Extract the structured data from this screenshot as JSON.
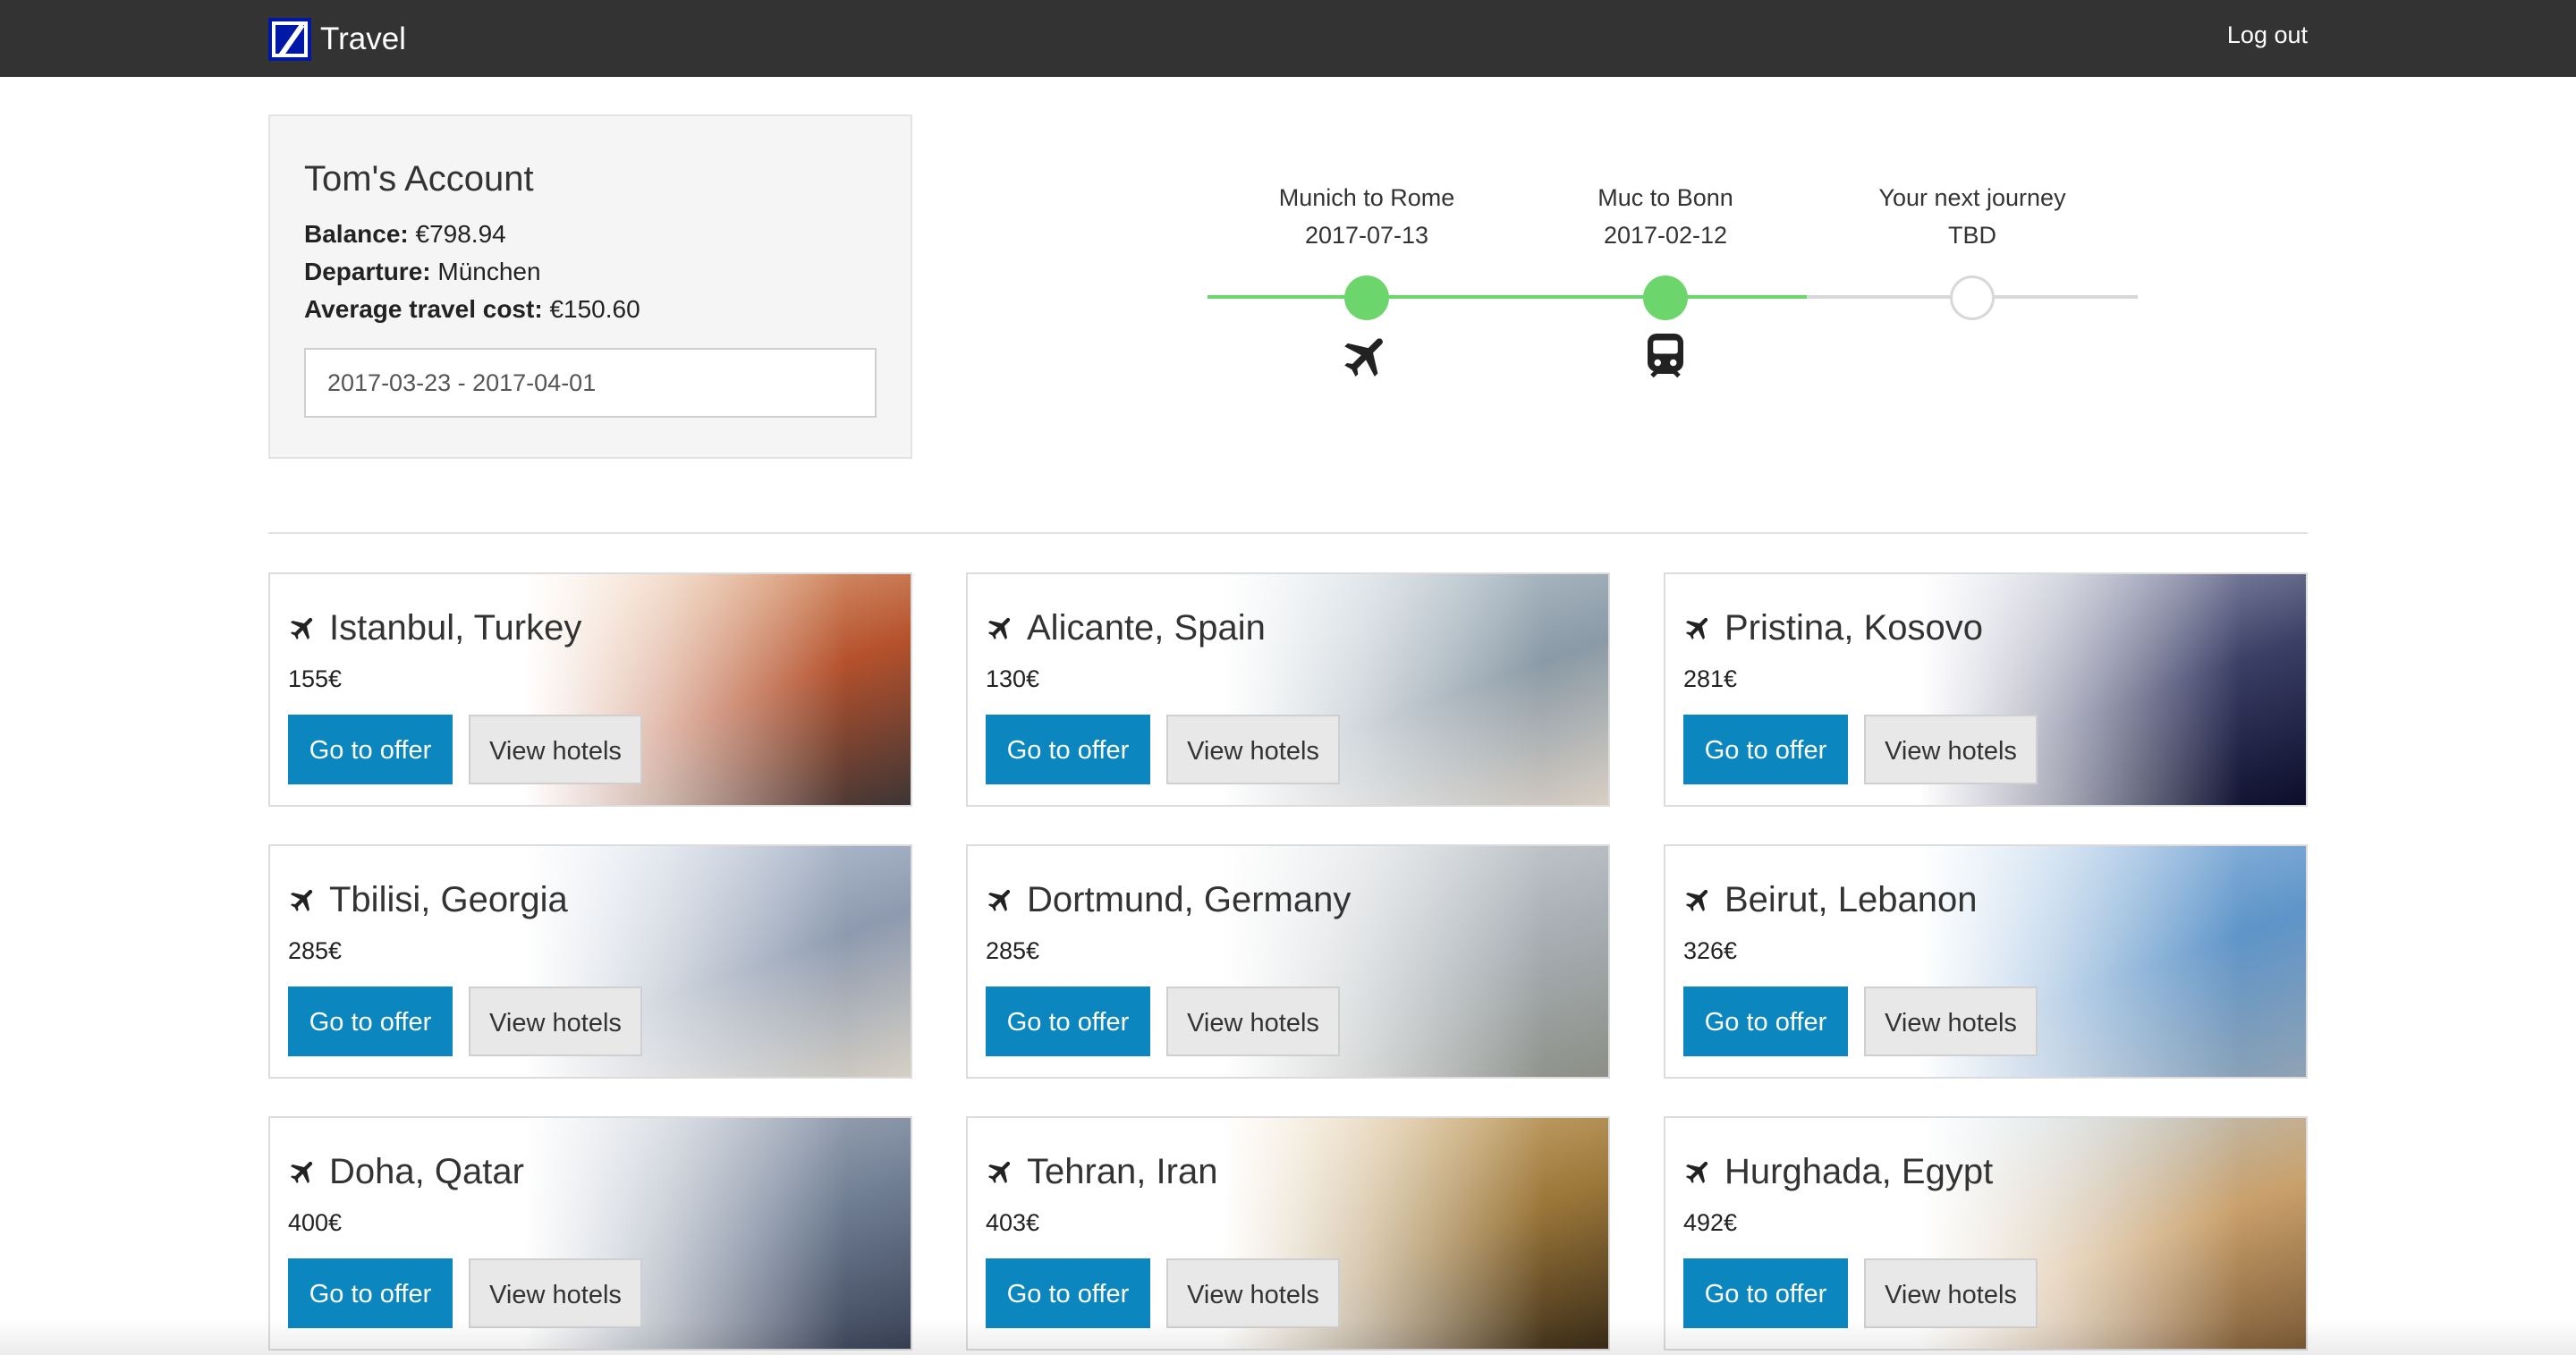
{
  "navbar": {
    "brand": "Travel",
    "logout": "Log out"
  },
  "account": {
    "title": "Tom's Account",
    "balance_label": "Balance:",
    "balance_value": "€798.94",
    "departure_label": "Departure:",
    "departure_value": "München",
    "avg_label": "Average travel cost:",
    "avg_value": "€150.60",
    "date_range": "2017-03-23 - 2017-04-01"
  },
  "timeline": {
    "stops": [
      {
        "title": "Munich to Rome",
        "date": "2017-07-13",
        "icon": "plane-icon",
        "status": "done"
      },
      {
        "title": "Muc to Bonn",
        "date": "2017-02-12",
        "icon": "train-icon",
        "status": "done"
      },
      {
        "title": "Your next journey",
        "date": "TBD",
        "icon": "",
        "status": "next"
      }
    ],
    "progress_color": "#6cd66c"
  },
  "offers": [
    {
      "city": "Istanbul, Turkey",
      "price": "155€",
      "offer_label": "Go to offer",
      "hotels_label": "View hotels",
      "colors": [
        "#f0c9a0",
        "#b5512c",
        "#3d3535"
      ]
    },
    {
      "city": "Alicante, Spain",
      "price": "130€",
      "offer_label": "Go to offer",
      "hotels_label": "View hotels",
      "colors": [
        "#c7d3dc",
        "#8a9aa6",
        "#d9cfc4"
      ]
    },
    {
      "city": "Pristina, Kosovo",
      "price": "281€",
      "offer_label": "Go to offer",
      "hotels_label": "View hotels",
      "colors": [
        "#b9bdd0",
        "#3b3f66",
        "#0b0d2a"
      ]
    },
    {
      "city": "Tbilisi, Georgia",
      "price": "285€",
      "offer_label": "Go to offer",
      "hotels_label": "View hotels",
      "colors": [
        "#c9d3e3",
        "#8d9aaf",
        "#d6d0c5"
      ]
    },
    {
      "city": "Dortmund, Germany",
      "price": "285€",
      "offer_label": "Go to offer",
      "hotels_label": "View hotels",
      "colors": [
        "#d7dbdf",
        "#a8afb4",
        "#8c8f87"
      ]
    },
    {
      "city": "Beirut, Lebanon",
      "price": "326€",
      "offer_label": "Go to offer",
      "hotels_label": "View hotels",
      "colors": [
        "#a9c8e6",
        "#5e94c9",
        "#8fa2b4"
      ]
    },
    {
      "city": "Doha, Qatar",
      "price": "400€",
      "offer_label": "Go to offer",
      "hotels_label": "View hotels",
      "colors": [
        "#bcc3cf",
        "#6f7d93",
        "#3a4257"
      ]
    },
    {
      "city": "Tehran, Iran",
      "price": "403€",
      "offer_label": "Go to offer",
      "hotels_label": "View hotels",
      "colors": [
        "#e3c48e",
        "#9b7639",
        "#3a2c18"
      ]
    },
    {
      "city": "Hurghada, Egypt",
      "price": "492€",
      "offer_label": "Go to offer",
      "hotels_label": "View hotels",
      "colors": [
        "#b7cfe0",
        "#c9a06b",
        "#7d5b37"
      ]
    }
  ],
  "colors": {
    "navbar": "#333333",
    "primary_button": "#0b86bf",
    "timeline_done": "#6cd66c"
  }
}
